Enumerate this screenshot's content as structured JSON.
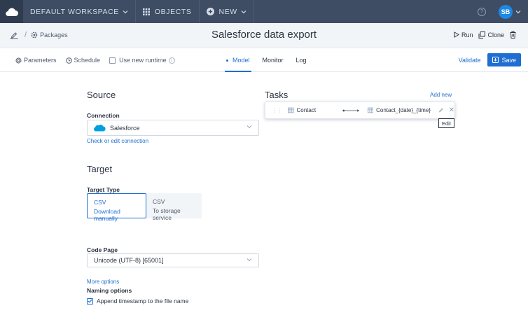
{
  "topnav": {
    "workspace": "DEFAULT WORKSPACE",
    "objects": "OBJECTS",
    "new": "NEW",
    "avatar_initials": "SB",
    "help": "?"
  },
  "titlebar": {
    "breadcrumb_packages": "Packages",
    "title": "Salesforce data export",
    "run": "Run",
    "clone": "Clone"
  },
  "toolbar": {
    "parameters": "Parameters",
    "schedule": "Schedule",
    "new_runtime": "Use new runtime",
    "tabs": [
      {
        "label": "Model",
        "active": true
      },
      {
        "label": "Monitor",
        "active": false
      },
      {
        "label": "Log",
        "active": false
      }
    ],
    "validate": "Validate",
    "save": "Save"
  },
  "source": {
    "heading": "Source",
    "connection_label": "Connection",
    "connection_value": "Salesforce",
    "check_link": "Check or edit connection"
  },
  "target": {
    "heading": "Target",
    "type_label": "Target Type",
    "options": [
      {
        "title": "CSV",
        "subtitle": "Download manually",
        "selected": true
      },
      {
        "title": "CSV",
        "subtitle": "To storage service",
        "selected": false
      }
    ],
    "code_page_label": "Code Page",
    "code_page_value": "Unicode (UTF-8) [65001]",
    "more_options": "More options",
    "naming_label": "Naming options",
    "append_timestamp": "Append timestamp to the file name",
    "append_checked": true
  },
  "tasks": {
    "heading": "Tasks",
    "add_new": "Add new",
    "rows": [
      {
        "source": "Contact",
        "target": "Contact_{date}_{time}"
      }
    ],
    "tooltip": "Edit"
  },
  "colors": {
    "nav_bg": "#3e4d63",
    "accent": "#1f6fd1",
    "avatar": "#1e88e5",
    "salesforce": "#00a1e0"
  }
}
